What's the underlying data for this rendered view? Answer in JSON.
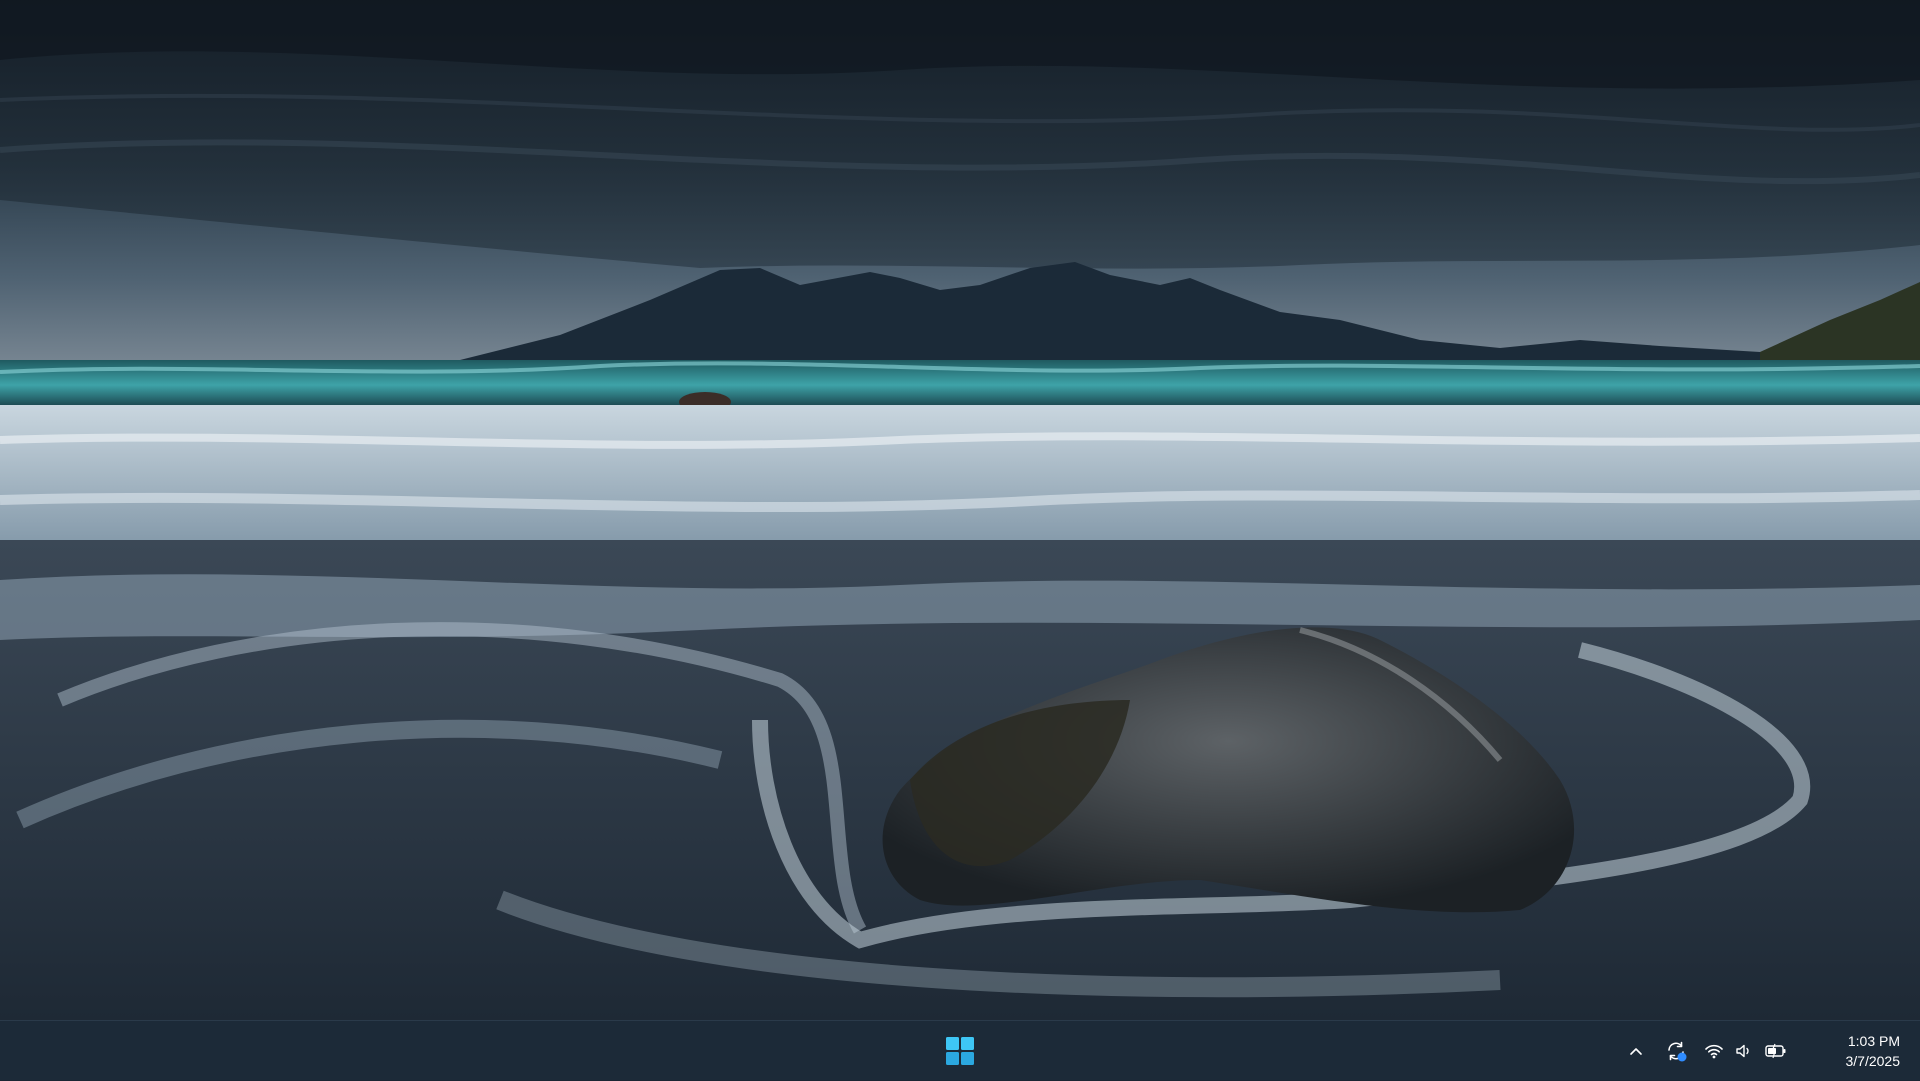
{
  "taskbar": {
    "start_icon": "windows-logo-icon",
    "tray": {
      "chevron_icon": "chevron-up-icon",
      "sync_icon": "sync-icon",
      "wifi_icon": "wifi-icon",
      "volume_icon": "volume-icon",
      "battery_icon": "battery-charging-icon",
      "time": "1:03 PM",
      "date": "3/7/2025"
    }
  },
  "colors": {
    "taskbar_bg": "#1c2a38",
    "windows_blue": "#3ec6f5",
    "sync_badge": "#2f8cff"
  }
}
